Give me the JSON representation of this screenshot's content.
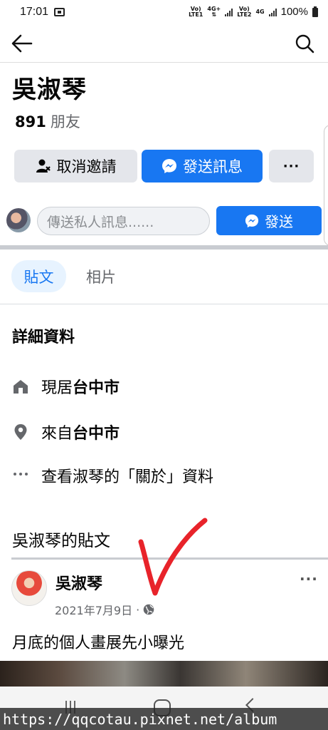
{
  "status_bar": {
    "time": "17:01",
    "sim1_top": "Vo)",
    "sim1_bottom": "LTE1",
    "net1": "4G+",
    "sim2_top": "Vo)",
    "sim2_bottom": "LTE2",
    "net2": "4G",
    "battery": "100%"
  },
  "profile": {
    "name": "吳淑琴",
    "friend_count": "891",
    "friend_label": "朋友"
  },
  "actions": {
    "cancel_invite": "取消邀請",
    "send_message": "發送訊息",
    "more": "···"
  },
  "composer": {
    "placeholder": "傳送私人訊息......",
    "send": "發送"
  },
  "tabs": [
    {
      "label": "貼文",
      "active": true
    },
    {
      "label": "相片",
      "active": false
    }
  ],
  "details": {
    "title": "詳細資料",
    "lives_prefix": "現居",
    "lives_value": "台中市",
    "from_prefix": "來自",
    "from_value": "台中市",
    "about_link": "查看淑琴的「關於」資料"
  },
  "posts": {
    "heading": "吳淑琴的貼文",
    "items": [
      {
        "author": "吳淑琴",
        "date": "2021年7月9日",
        "separator": "·",
        "more": "···",
        "text": "月底的個人畫展先小曝光"
      }
    ]
  },
  "watermark": "https://qqcotau.pixnet.net/album",
  "colors": {
    "accent": "#1877f2",
    "secondary_button": "#e4e6eb",
    "annotation": "#e8232a"
  }
}
